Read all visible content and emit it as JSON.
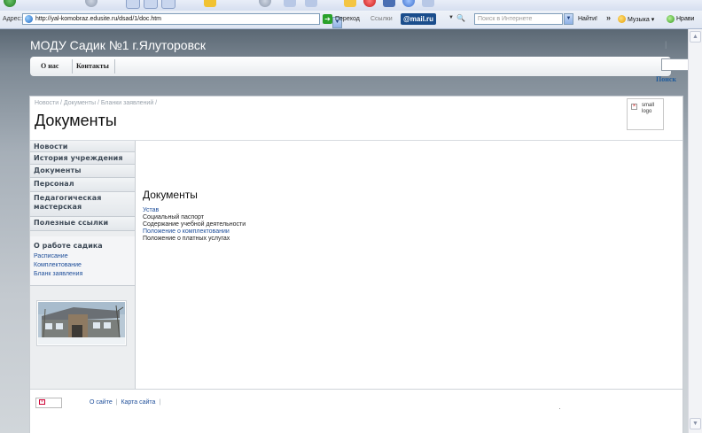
{
  "browser": {
    "address_label": "Адрес:",
    "url": "http://yal-komobraz.edusite.ru/dsad/1/doc.htm",
    "go_label": "Переход",
    "links_label": "Ссылки",
    "mailru_label": "@mail.ru",
    "search_placeholder": "Поиск в Интернете",
    "find_label": "Найти!",
    "chevron": "»",
    "music_label": "Музыка ▾",
    "like_label": "Нрави"
  },
  "site": {
    "title": "МОДУ Садик №1 г.Ялуторовск",
    "pipe": "|",
    "nav": [
      "О нас",
      "Контакты"
    ],
    "search_button": "Поиск"
  },
  "page": {
    "breadcrumb": "Новости / Документы / Бланки заявлений /",
    "title": "Документы",
    "logo_alt": "small logo"
  },
  "sidebar": {
    "items": [
      "Новости",
      "История учреждения",
      "Документы",
      "Персонал",
      "Педагогическая мастерская",
      "Полезные ссылки"
    ],
    "sub_title": "О работе садика",
    "sub_links": [
      "Расписание",
      "Комплектование",
      "Бланк заявления"
    ]
  },
  "main": {
    "heading": "Документы",
    "documents": [
      {
        "text": "Устав",
        "link": true
      },
      {
        "text": "Социальный паспорт",
        "link": false
      },
      {
        "text": "Содержание учебной деятельности",
        "link": false
      },
      {
        "text": "Положение о комплектовании",
        "link": true
      },
      {
        "text": "Положение о платных услугах",
        "link": false
      }
    ]
  },
  "footer": {
    "about": "О сайте",
    "sitemap": "Карта сайта",
    "sep": "|"
  },
  "colors": {
    "link": "#1f4f9a",
    "header_bg_top": "#5b6874",
    "sidebar_bg": "#eceef0"
  }
}
